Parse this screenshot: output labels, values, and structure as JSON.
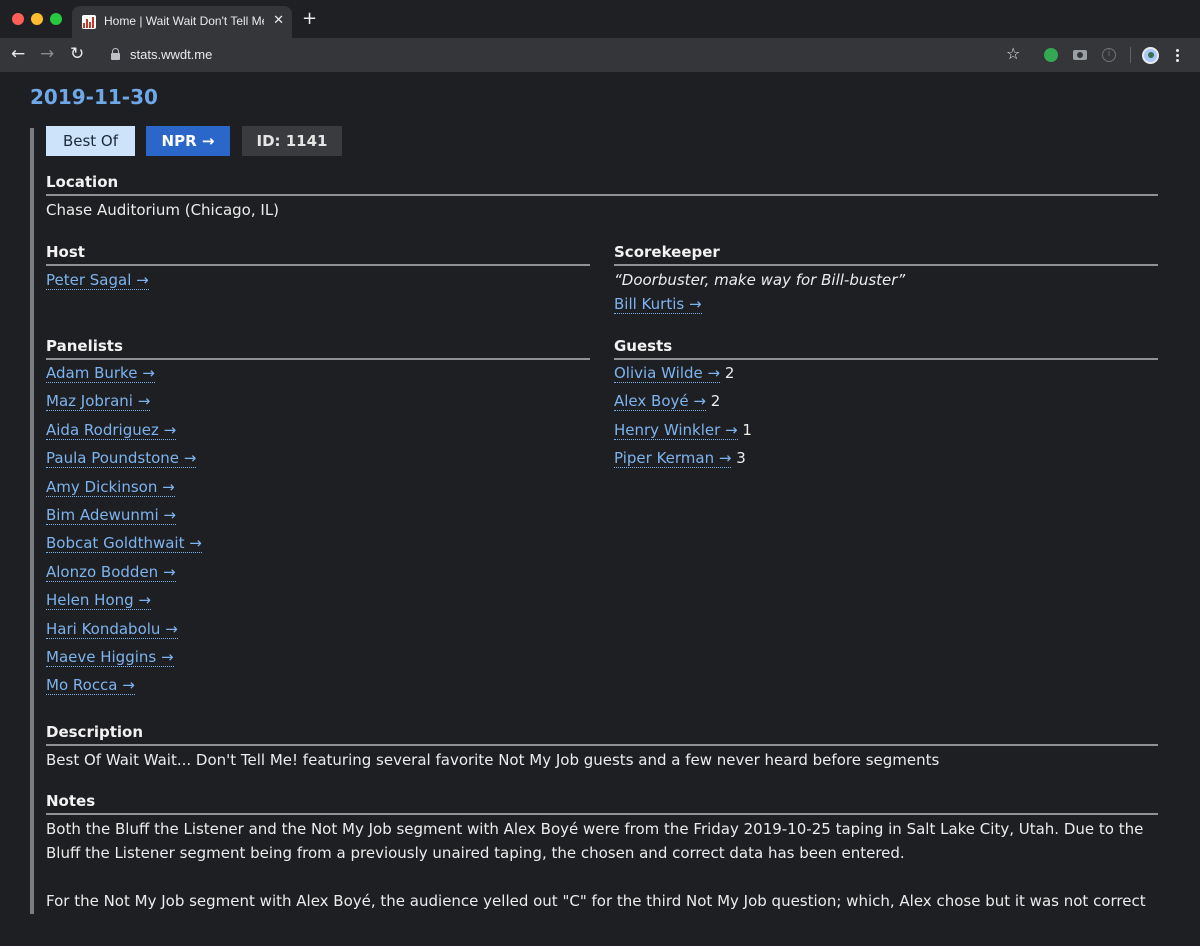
{
  "browser": {
    "tab_title": "Home | Wait Wait Don't Tell Me! Stats",
    "tab_close": "✕",
    "new_tab": "+",
    "url": "stats.wwdt.me",
    "nav": {
      "back": "←",
      "forward": "→",
      "reload": "↻"
    },
    "star": "☆",
    "info": "i",
    "icons": [
      "lock-icon",
      "star-icon",
      "extension-icon",
      "camera-icon",
      "info-icon",
      "avatar",
      "menu-icon"
    ]
  },
  "show": {
    "date": "2019-11-30",
    "badges": {
      "best_of": "Best Of",
      "npr": "NPR →",
      "id": "ID: 1141"
    },
    "location": {
      "heading": "Location",
      "value": "Chase Auditorium (Chicago, IL)"
    },
    "host": {
      "heading": "Host",
      "name": "Peter Sagal →"
    },
    "scorekeeper": {
      "heading": "Scorekeeper",
      "quote": "“Doorbuster, make way for Bill-buster”",
      "name": "Bill Kurtis →"
    },
    "panelists": {
      "heading": "Panelists",
      "items": [
        "Adam Burke →",
        "Maz Jobrani →",
        "Aida Rodriguez →",
        "Paula Poundstone →",
        "Amy Dickinson →",
        "Bim Adewunmi →",
        "Bobcat Goldthwait →",
        "Alonzo Bodden →",
        "Helen Hong →",
        "Hari Kondabolu →",
        "Maeve Higgins →",
        "Mo Rocca →"
      ]
    },
    "guests": {
      "heading": "Guests",
      "items": [
        {
          "name": "Olivia Wilde →",
          "score": "2"
        },
        {
          "name": "Alex Boyé →",
          "score": "2"
        },
        {
          "name": "Henry Winkler →",
          "score": "1"
        },
        {
          "name": "Piper Kerman →",
          "score": "3"
        }
      ]
    },
    "description": {
      "heading": "Description",
      "text": "Best Of Wait Wait... Don't Tell Me! featuring several favorite Not My Job guests and a few never heard before segments"
    },
    "notes": {
      "heading": "Notes",
      "paragraph1": "Both the Bluff the Listener and the Not My Job segment with Alex Boyé were from the Friday 2019-10-25 taping in Salt Lake City, Utah. Due to the Bluff the Listener segment being from a previously unaired taping, the chosen and correct data has been entered.",
      "paragraph2": "For the Not My Job segment with Alex Boyé, the audience yelled out \"C\" for the third Not My Job question; which, Alex chose but it was not correct"
    }
  },
  "colors": {
    "page_bg": "#1e1f22",
    "link": "#7db3ee",
    "date": "#6ea8e8",
    "npr_badge": "#2b67c8",
    "bestof_badge": "#cde3f9"
  }
}
